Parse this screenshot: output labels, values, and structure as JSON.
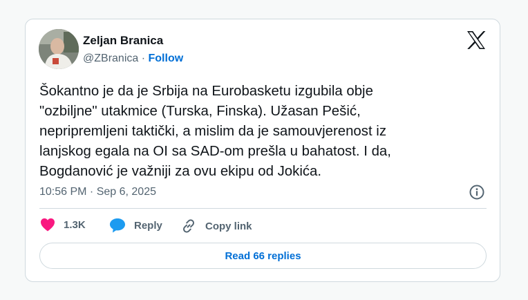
{
  "author": {
    "name": "Zeljan Branica",
    "handle": "@ZBranica",
    "separator": "·",
    "follow_label": "Follow"
  },
  "tweet": {
    "lines": [
      "Šokantno je da je Srbija na Eurobasketu izgubila obje",
      "\"ozbiljne\" utakmice (Turska, Finska). Užasan Pešić,",
      "nepripremljeni taktički, a mislim da je samouvjerenost iz",
      "lanjskog egala na OI sa SAD-om prešla u bahatost. I da,",
      "Bogdanović je važniji za ovu ekipu od Jokića."
    ],
    "timestamp": "10:56 PM · Sep 6, 2025"
  },
  "actions": {
    "like_count": "1.3K",
    "reply_label": "Reply",
    "copy_label": "Copy link"
  },
  "read_replies_label": "Read 66 replies",
  "colors": {
    "text": "#0f1419",
    "muted": "#536471",
    "link": "#006fd6",
    "like": "#f91880",
    "reply": "#1d9bf0",
    "border": "#cfd9de"
  },
  "icons": [
    "x-logo-icon",
    "info-icon",
    "heart-icon",
    "reply-bubble-icon",
    "link-icon"
  ]
}
